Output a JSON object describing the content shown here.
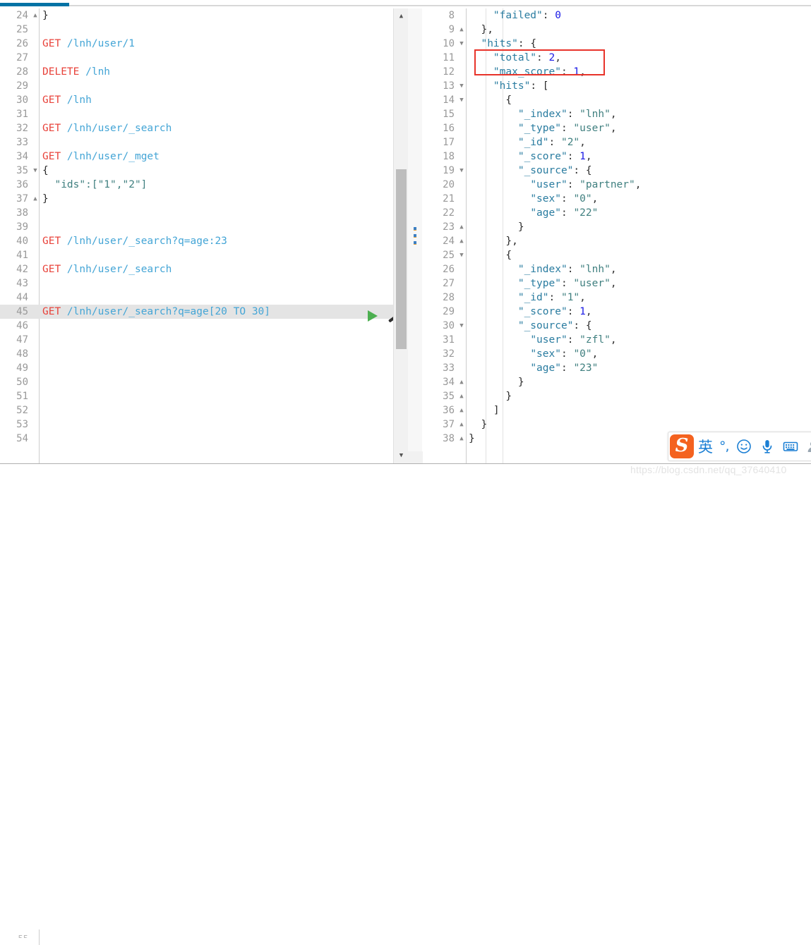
{
  "window": {
    "tab_active_indicator": true,
    "accent_color": "#0273a5",
    "annotation_color": "#e8332a"
  },
  "left_editor": {
    "name": "request-editor",
    "scrollbar": {
      "up_arrow": "▲",
      "down_arrow": "▼"
    },
    "lines": [
      {
        "num": "24",
        "fold": "▲",
        "text": "}",
        "cls": "k-brace"
      },
      {
        "num": "25",
        "fold": "",
        "text": "",
        "cls": ""
      },
      {
        "num": "26",
        "fold": "",
        "method": "GET",
        "path": " /lnh/user/1"
      },
      {
        "num": "27",
        "fold": "",
        "text": "",
        "cls": ""
      },
      {
        "num": "28",
        "fold": "",
        "method": "DELETE",
        "path": " /lnh"
      },
      {
        "num": "29",
        "fold": "",
        "text": "",
        "cls": ""
      },
      {
        "num": "30",
        "fold": "",
        "method": "GET",
        "path": " /lnh"
      },
      {
        "num": "31",
        "fold": "",
        "text": "",
        "cls": ""
      },
      {
        "num": "32",
        "fold": "",
        "method": "GET",
        "path": " /lnh/user/_search"
      },
      {
        "num": "33",
        "fold": "",
        "text": "",
        "cls": ""
      },
      {
        "num": "34",
        "fold": "",
        "method": "GET",
        "path": " /lnh/user/_mget"
      },
      {
        "num": "35",
        "fold": "▼",
        "text": "{",
        "cls": "k-brace"
      },
      {
        "num": "36",
        "fold": "",
        "text": "  \"ids\":[\"1\",\"2\"]",
        "cls": "k-string"
      },
      {
        "num": "37",
        "fold": "▲",
        "text": "}",
        "cls": "k-brace"
      },
      {
        "num": "38",
        "fold": "",
        "text": "",
        "cls": ""
      },
      {
        "num": "39",
        "fold": "",
        "text": "",
        "cls": ""
      },
      {
        "num": "40",
        "fold": "",
        "method": "GET",
        "path": " /lnh/user/_search?q=age:23"
      },
      {
        "num": "41",
        "fold": "",
        "text": "",
        "cls": ""
      },
      {
        "num": "42",
        "fold": "",
        "method": "GET",
        "path": " /lnh/user/_search"
      },
      {
        "num": "43",
        "fold": "",
        "text": "",
        "cls": ""
      },
      {
        "num": "44",
        "fold": "",
        "text": "",
        "cls": ""
      },
      {
        "num": "45",
        "fold": "",
        "method": "GET",
        "path": " /lnh/user/_search?q=age[20 TO 30]",
        "highlight": true
      },
      {
        "num": "46",
        "fold": "",
        "text": "",
        "cls": ""
      },
      {
        "num": "47",
        "fold": "",
        "text": "",
        "cls": ""
      },
      {
        "num": "48",
        "fold": "",
        "text": "",
        "cls": ""
      },
      {
        "num": "49",
        "fold": "",
        "text": "",
        "cls": ""
      },
      {
        "num": "50",
        "fold": "",
        "text": "",
        "cls": ""
      },
      {
        "num": "51",
        "fold": "",
        "text": "",
        "cls": ""
      },
      {
        "num": "52",
        "fold": "",
        "text": "",
        "cls": ""
      },
      {
        "num": "53",
        "fold": "",
        "text": "",
        "cls": ""
      },
      {
        "num": "54",
        "fold": "",
        "text": "",
        "cls": ""
      }
    ],
    "run_button_label": "run-query",
    "wrench_button_label": "settings-wrench"
  },
  "right_editor": {
    "name": "response-viewer",
    "lines": [
      {
        "num": "8",
        "fold": "",
        "text": "    \"failed\": 0",
        "parts": [
          {
            "t": "    ",
            "c": "k-punct"
          },
          {
            "t": "\"failed\"",
            "c": "k-key"
          },
          {
            "t": ": ",
            "c": "k-punct"
          },
          {
            "t": "0",
            "c": "k-num"
          }
        ]
      },
      {
        "num": "9",
        "fold": "▲",
        "parts": [
          {
            "t": "  },",
            "c": "k-brace"
          }
        ]
      },
      {
        "num": "10",
        "fold": "▼",
        "parts": [
          {
            "t": "  ",
            "c": "k-punct"
          },
          {
            "t": "\"hits\"",
            "c": "k-key"
          },
          {
            "t": ": {",
            "c": "k-brace"
          }
        ]
      },
      {
        "num": "11",
        "fold": "",
        "parts": [
          {
            "t": "    ",
            "c": "k-punct"
          },
          {
            "t": "\"total\"",
            "c": "k-key"
          },
          {
            "t": ": ",
            "c": "k-punct"
          },
          {
            "t": "2",
            "c": "k-num"
          },
          {
            "t": ",",
            "c": "k-punct"
          }
        ]
      },
      {
        "num": "12",
        "fold": "",
        "parts": [
          {
            "t": "    ",
            "c": "k-punct"
          },
          {
            "t": "\"max_score\"",
            "c": "k-key"
          },
          {
            "t": ": ",
            "c": "k-punct"
          },
          {
            "t": "1",
            "c": "k-num"
          },
          {
            "t": ",",
            "c": "k-punct"
          }
        ]
      },
      {
        "num": "13",
        "fold": "▼",
        "parts": [
          {
            "t": "    ",
            "c": "k-punct"
          },
          {
            "t": "\"hits\"",
            "c": "k-key"
          },
          {
            "t": ": [",
            "c": "k-brace"
          }
        ]
      },
      {
        "num": "14",
        "fold": "▼",
        "parts": [
          {
            "t": "      {",
            "c": "k-brace"
          }
        ]
      },
      {
        "num": "15",
        "fold": "",
        "parts": [
          {
            "t": "        ",
            "c": "k-punct"
          },
          {
            "t": "\"_index\"",
            "c": "k-key"
          },
          {
            "t": ": ",
            "c": "k-punct"
          },
          {
            "t": "\"lnh\"",
            "c": "k-string"
          },
          {
            "t": ",",
            "c": "k-punct"
          }
        ]
      },
      {
        "num": "16",
        "fold": "",
        "parts": [
          {
            "t": "        ",
            "c": "k-punct"
          },
          {
            "t": "\"_type\"",
            "c": "k-key"
          },
          {
            "t": ": ",
            "c": "k-punct"
          },
          {
            "t": "\"user\"",
            "c": "k-string"
          },
          {
            "t": ",",
            "c": "k-punct"
          }
        ]
      },
      {
        "num": "17",
        "fold": "",
        "parts": [
          {
            "t": "        ",
            "c": "k-punct"
          },
          {
            "t": "\"_id\"",
            "c": "k-key"
          },
          {
            "t": ": ",
            "c": "k-punct"
          },
          {
            "t": "\"2\"",
            "c": "k-string"
          },
          {
            "t": ",",
            "c": "k-punct"
          }
        ]
      },
      {
        "num": "18",
        "fold": "",
        "parts": [
          {
            "t": "        ",
            "c": "k-punct"
          },
          {
            "t": "\"_score\"",
            "c": "k-key"
          },
          {
            "t": ": ",
            "c": "k-punct"
          },
          {
            "t": "1",
            "c": "k-num"
          },
          {
            "t": ",",
            "c": "k-punct"
          }
        ]
      },
      {
        "num": "19",
        "fold": "▼",
        "parts": [
          {
            "t": "        ",
            "c": "k-punct"
          },
          {
            "t": "\"_source\"",
            "c": "k-key"
          },
          {
            "t": ": {",
            "c": "k-brace"
          }
        ]
      },
      {
        "num": "20",
        "fold": "",
        "parts": [
          {
            "t": "          ",
            "c": "k-punct"
          },
          {
            "t": "\"user\"",
            "c": "k-key"
          },
          {
            "t": ": ",
            "c": "k-punct"
          },
          {
            "t": "\"partner\"",
            "c": "k-string"
          },
          {
            "t": ",",
            "c": "k-punct"
          }
        ]
      },
      {
        "num": "21",
        "fold": "",
        "parts": [
          {
            "t": "          ",
            "c": "k-punct"
          },
          {
            "t": "\"sex\"",
            "c": "k-key"
          },
          {
            "t": ": ",
            "c": "k-punct"
          },
          {
            "t": "\"0\"",
            "c": "k-string"
          },
          {
            "t": ",",
            "c": "k-punct"
          }
        ]
      },
      {
        "num": "22",
        "fold": "",
        "parts": [
          {
            "t": "          ",
            "c": "k-punct"
          },
          {
            "t": "\"age\"",
            "c": "k-key"
          },
          {
            "t": ": ",
            "c": "k-punct"
          },
          {
            "t": "\"22\"",
            "c": "k-string"
          }
        ]
      },
      {
        "num": "23",
        "fold": "▲",
        "parts": [
          {
            "t": "        }",
            "c": "k-brace"
          }
        ]
      },
      {
        "num": "24",
        "fold": "▲",
        "parts": [
          {
            "t": "      },",
            "c": "k-brace"
          }
        ]
      },
      {
        "num": "25",
        "fold": "▼",
        "parts": [
          {
            "t": "      {",
            "c": "k-brace"
          }
        ]
      },
      {
        "num": "26",
        "fold": "",
        "parts": [
          {
            "t": "        ",
            "c": "k-punct"
          },
          {
            "t": "\"_index\"",
            "c": "k-key"
          },
          {
            "t": ": ",
            "c": "k-punct"
          },
          {
            "t": "\"lnh\"",
            "c": "k-string"
          },
          {
            "t": ",",
            "c": "k-punct"
          }
        ]
      },
      {
        "num": "27",
        "fold": "",
        "parts": [
          {
            "t": "        ",
            "c": "k-punct"
          },
          {
            "t": "\"_type\"",
            "c": "k-key"
          },
          {
            "t": ": ",
            "c": "k-punct"
          },
          {
            "t": "\"user\"",
            "c": "k-string"
          },
          {
            "t": ",",
            "c": "k-punct"
          }
        ]
      },
      {
        "num": "28",
        "fold": "",
        "parts": [
          {
            "t": "        ",
            "c": "k-punct"
          },
          {
            "t": "\"_id\"",
            "c": "k-key"
          },
          {
            "t": ": ",
            "c": "k-punct"
          },
          {
            "t": "\"1\"",
            "c": "k-string"
          },
          {
            "t": ",",
            "c": "k-punct"
          }
        ]
      },
      {
        "num": "29",
        "fold": "",
        "parts": [
          {
            "t": "        ",
            "c": "k-punct"
          },
          {
            "t": "\"_score\"",
            "c": "k-key"
          },
          {
            "t": ": ",
            "c": "k-punct"
          },
          {
            "t": "1",
            "c": "k-num"
          },
          {
            "t": ",",
            "c": "k-punct"
          }
        ]
      },
      {
        "num": "30",
        "fold": "▼",
        "parts": [
          {
            "t": "        ",
            "c": "k-punct"
          },
          {
            "t": "\"_source\"",
            "c": "k-key"
          },
          {
            "t": ": {",
            "c": "k-brace"
          }
        ]
      },
      {
        "num": "31",
        "fold": "",
        "parts": [
          {
            "t": "          ",
            "c": "k-punct"
          },
          {
            "t": "\"user\"",
            "c": "k-key"
          },
          {
            "t": ": ",
            "c": "k-punct"
          },
          {
            "t": "\"zfl\"",
            "c": "k-string"
          },
          {
            "t": ",",
            "c": "k-punct"
          }
        ]
      },
      {
        "num": "32",
        "fold": "",
        "parts": [
          {
            "t": "          ",
            "c": "k-punct"
          },
          {
            "t": "\"sex\"",
            "c": "k-key"
          },
          {
            "t": ": ",
            "c": "k-punct"
          },
          {
            "t": "\"0\"",
            "c": "k-string"
          },
          {
            "t": ",",
            "c": "k-punct"
          }
        ]
      },
      {
        "num": "33",
        "fold": "",
        "parts": [
          {
            "t": "          ",
            "c": "k-punct"
          },
          {
            "t": "\"age\"",
            "c": "k-key"
          },
          {
            "t": ": ",
            "c": "k-punct"
          },
          {
            "t": "\"23\"",
            "c": "k-string"
          }
        ]
      },
      {
        "num": "34",
        "fold": "▲",
        "parts": [
          {
            "t": "        }",
            "c": "k-brace"
          }
        ]
      },
      {
        "num": "35",
        "fold": "▲",
        "parts": [
          {
            "t": "      }",
            "c": "k-brace"
          }
        ]
      },
      {
        "num": "36",
        "fold": "▲",
        "parts": [
          {
            "t": "    ]",
            "c": "k-brace"
          }
        ]
      },
      {
        "num": "37",
        "fold": "▲",
        "parts": [
          {
            "t": "  }",
            "c": "k-brace"
          }
        ]
      },
      {
        "num": "38",
        "fold": "▲",
        "parts": [
          {
            "t": "}",
            "c": "k-brace"
          }
        ]
      }
    ],
    "annotation": {
      "label": "hits-total-highlight",
      "covers_lines": [
        "10",
        "11"
      ]
    }
  },
  "ime_toolbar": {
    "logo": "S",
    "mode_label": "英",
    "punct_label": "°,",
    "items": [
      {
        "name": "sogou-logo-icon",
        "label": "S"
      },
      {
        "name": "ime-language-mode-icon",
        "label": "英"
      },
      {
        "name": "ime-punctuation-icon",
        "label": "°,"
      },
      {
        "name": "ime-emoji-icon",
        "label": "☺"
      },
      {
        "name": "ime-voice-input-icon",
        "label": "mic"
      },
      {
        "name": "ime-soft-keyboard-icon",
        "label": "keyboard"
      },
      {
        "name": "ime-user-icon",
        "label": "user"
      }
    ]
  },
  "watermark": {
    "text": "https://blog.csdn.net/qq_37640410"
  }
}
